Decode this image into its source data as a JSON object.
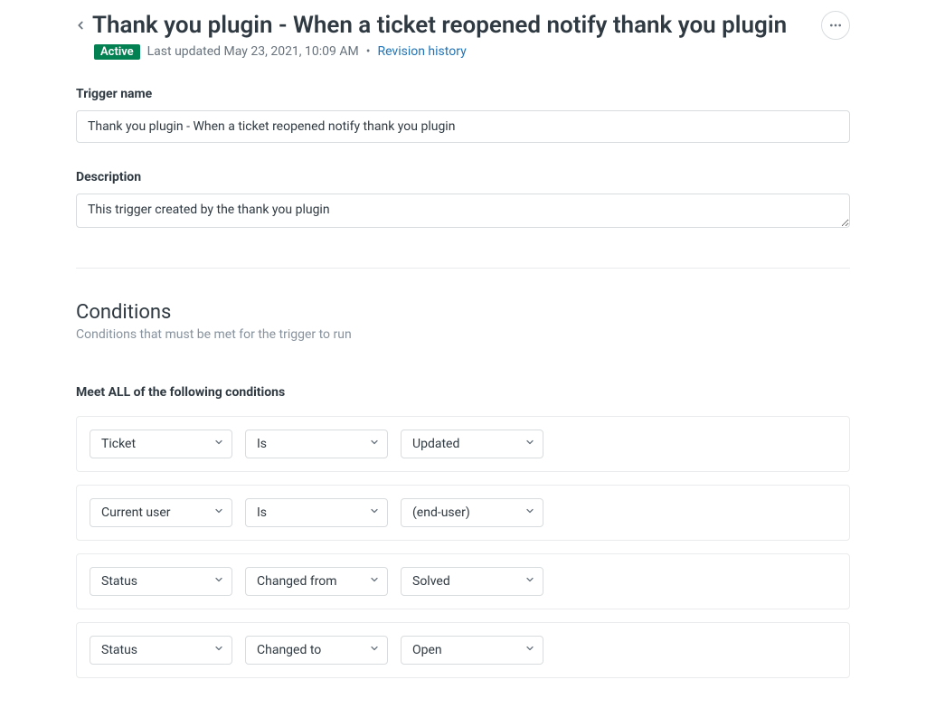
{
  "header": {
    "title": "Thank you plugin - When a ticket reopened notify thank you plugin",
    "badge": "Active",
    "last_updated": "Last updated May 23, 2021, 10:09 AM",
    "separator": "•",
    "revision_link": "Revision history"
  },
  "fields": {
    "trigger_name": {
      "label": "Trigger name",
      "value": "Thank you plugin - When a ticket reopened notify thank you plugin"
    },
    "description": {
      "label": "Description",
      "value": "This trigger created by the thank you plugin"
    }
  },
  "conditions_section": {
    "heading": "Conditions",
    "sub": "Conditions that must be met for the trigger to run",
    "all_heading": "Meet ALL of the following conditions",
    "rows": [
      {
        "field": "Ticket",
        "operator": "Is",
        "value": "Updated"
      },
      {
        "field": "Current user",
        "operator": "Is",
        "value": "(end-user)"
      },
      {
        "field": "Status",
        "operator": "Changed from",
        "value": "Solved"
      },
      {
        "field": "Status",
        "operator": "Changed to",
        "value": "Open"
      }
    ]
  }
}
